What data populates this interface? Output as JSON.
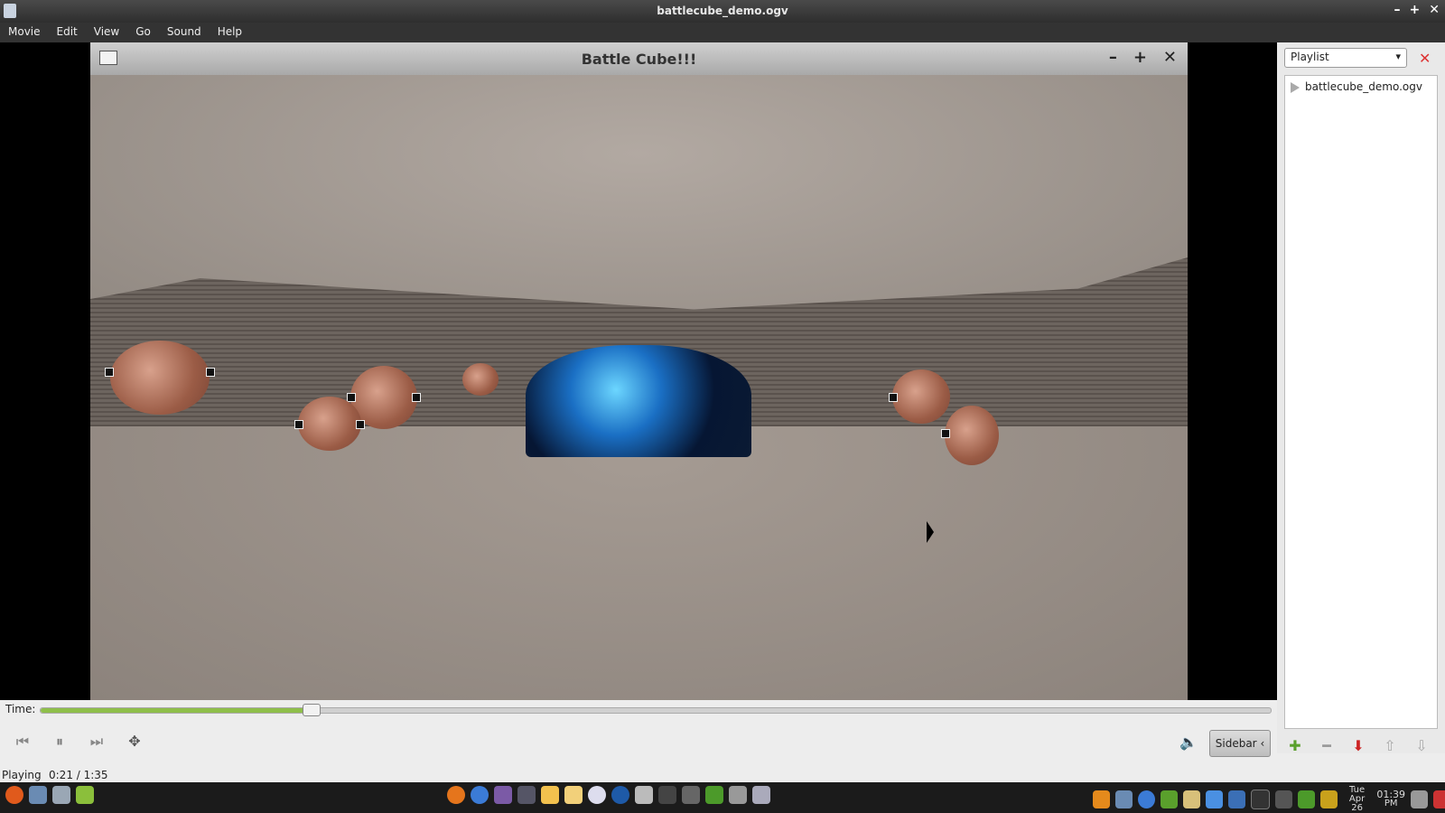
{
  "window": {
    "title": "battlecube_demo.ogv"
  },
  "menubar": {
    "items": [
      "Movie",
      "Edit",
      "View",
      "Go",
      "Sound",
      "Help"
    ]
  },
  "game_window": {
    "title": "Battle Cube!!!",
    "buttons": [
      "–",
      "+",
      "✕"
    ]
  },
  "sidebar": {
    "dropdown_value": "Playlist",
    "playlist_items": [
      "battlecube_demo.ogv"
    ]
  },
  "timeline": {
    "label": "Time:",
    "progress": 0.22
  },
  "controls": {
    "sidebar_label": "Sidebar"
  },
  "status": {
    "state": "Playing",
    "time": "0:21 / 1:35"
  },
  "taskbar": {
    "clock_time": "01:39",
    "clock_period": "PM",
    "clock_day": "Tue",
    "clock_date": "Apr 26"
  }
}
